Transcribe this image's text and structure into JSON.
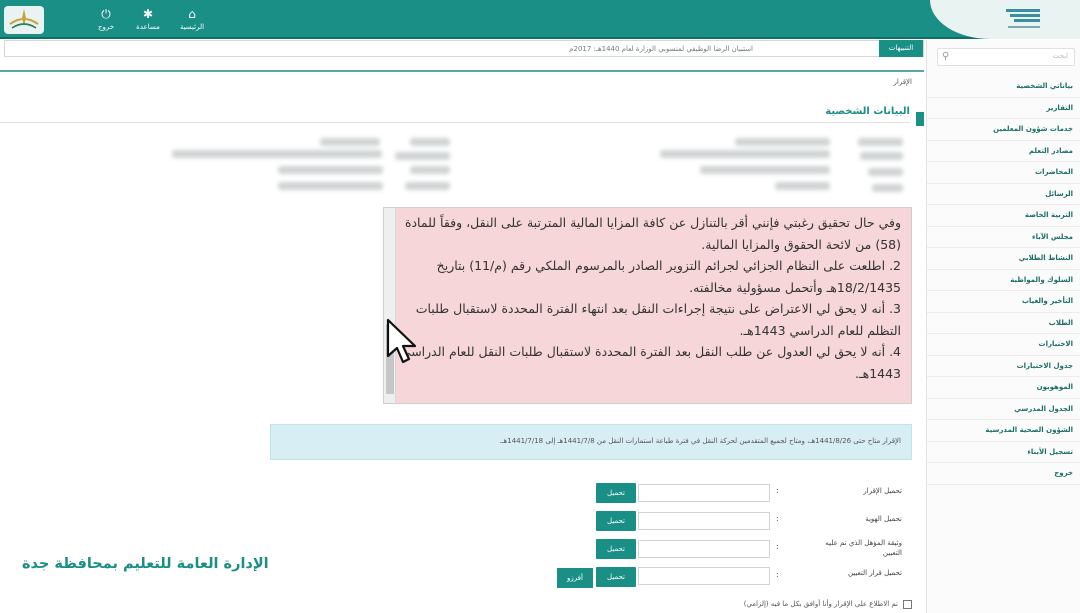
{
  "header": {
    "nav": [
      {
        "label": "الرئيسية",
        "icon": "home-icon"
      },
      {
        "label": "مساعدة",
        "icon": "gear-icon"
      },
      {
        "label": "خروج",
        "icon": "power-icon"
      }
    ],
    "colors": {
      "primary": "#1a8f86"
    }
  },
  "ticker": {
    "tag": "التنبيهات",
    "message": "استبيان الرضا الوظيفي لمنسوبي الوزارة لعام 1440هـ: 2017م"
  },
  "sidebar": {
    "search_placeholder": "ابحث",
    "items": [
      "بياناتي الشخصية",
      "التقارير",
      "خدمات شؤون المعلمين",
      "مصادر التعلم",
      "المحاضرات",
      "الرسائل",
      "التربية الخاصة",
      "مجلس الآباء",
      "النشاط الطلابي",
      "السلوك والمواظبة",
      "التأخير والغياب",
      "الطلاب",
      "الاختبارات",
      "جدول الاختبارات",
      "الموهوبون",
      "الجدول المدرسي",
      "الشؤون الصحية المدرسية",
      "تسجيل الأبناء",
      "خروج"
    ]
  },
  "main": {
    "breadcrumb": "الإقرار",
    "section_title": "البيانات الشخصية",
    "terms": [
      "وفي حال تحقيق رغبتي فإنني أقر بالتنازل عن كافة المزايا المالية المترتبة على النقل، وفقاً للمادة (58) من لائحة الحقوق والمزايا المالية.",
      "2. اطلعت على النظام الجزائي لجرائم التزوير الصادر بالمرسوم الملكي رقم (م/11) بتاريخ 18/2/1435هـ وأتحمل مسؤولية مخالفته.",
      "3. أنه لا يحق لي الاعتراض على نتيجة إجراءات النقل بعد انتهاء الفترة المحددة لاستقبال طلبات التظلم للعام الدراسي 1443هـ.",
      "4. أنه لا يحق لي العدول عن طلب النقل بعد الفترة المحددة لاستقبال طلبات النقل للعام الدراسي 1443هـ."
    ],
    "info_text": "الإقرار متاح حتى 1441/8/26هـ، ومتاح لجميع المتقدمين لحركة النقل في فترة طباعة استمارات النقل من 1441/7/8هـ إلى 1441/7/18هـ.",
    "form": [
      {
        "label": "تحميل الإقرار",
        "button": "تحميل"
      },
      {
        "label": "تحميل الهوية",
        "button": "تحميل"
      },
      {
        "label": "وثيقة المؤهل الذي تم عليه التعيين",
        "button": "تحميل"
      },
      {
        "label": "تحميل قرار التعيين",
        "button": "تحميل"
      }
    ],
    "colon": ":",
    "upload_button": "أفرزو",
    "agree_label": "تم الاطلاع على الإقرار وأنا أوافق بكل ما فيه (إلزامي)"
  },
  "watermark": "الإدارة العامة للتعليم بمحافظة جدة"
}
